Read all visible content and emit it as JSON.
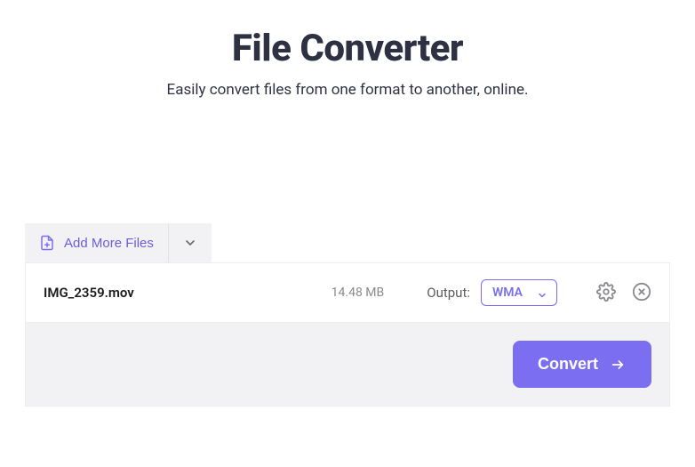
{
  "header": {
    "title": "File Converter",
    "subtitle": "Easily convert files from one format to another, online."
  },
  "toolbar": {
    "add_label": "Add More Files"
  },
  "file": {
    "name": "IMG_2359.mov",
    "size": "14.48 MB",
    "output_label": "Output:",
    "format": "WMA"
  },
  "actions": {
    "convert_label": "Convert"
  },
  "colors": {
    "accent": "#7b6ef0",
    "text_dark": "#2d3142",
    "muted": "#8a8a8f",
    "panel_bg": "#f2f2f5"
  }
}
